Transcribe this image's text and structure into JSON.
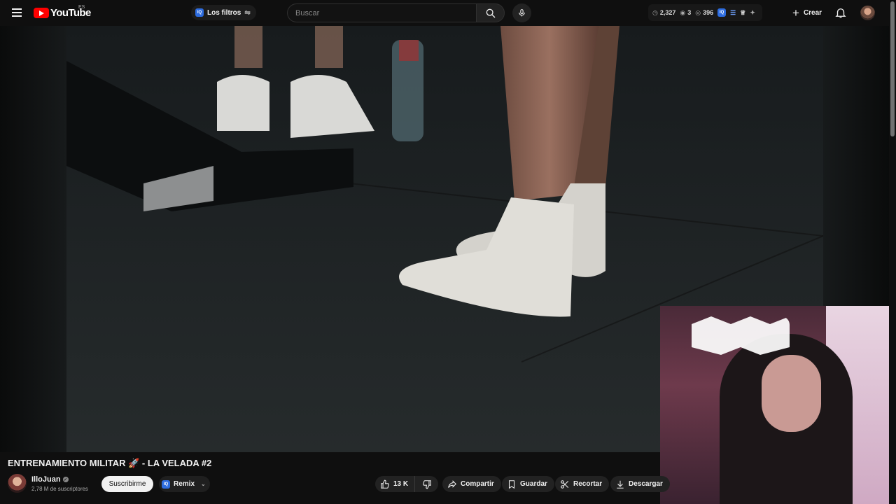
{
  "header": {
    "logo_text": "YouTube",
    "region": "ES",
    "filters_label": "Los filtros",
    "iq_badge": "IQ",
    "search_placeholder": "Buscar",
    "stats": {
      "views": "2,327",
      "watching": "3",
      "other": "396"
    },
    "create_label": "Crear"
  },
  "video": {
    "title": "ENTRENAMIENTO MILITAR 🚀 - LA VELADA #2"
  },
  "channel": {
    "name": "IlloJuan",
    "subscribers": "2,78 M de suscriptores",
    "subscribe_label": "Suscribirme",
    "remix_label": "Remix"
  },
  "actions": {
    "likes": "13 K",
    "share_label": "Compartir",
    "save_label": "Guardar",
    "clip_label": "Recortar",
    "download_label": "Descargar"
  },
  "colors": {
    "background": "#0f0f0f",
    "brand_red": "#ff0000",
    "accent_blue": "#2d6cdf",
    "pill": "#222222"
  }
}
